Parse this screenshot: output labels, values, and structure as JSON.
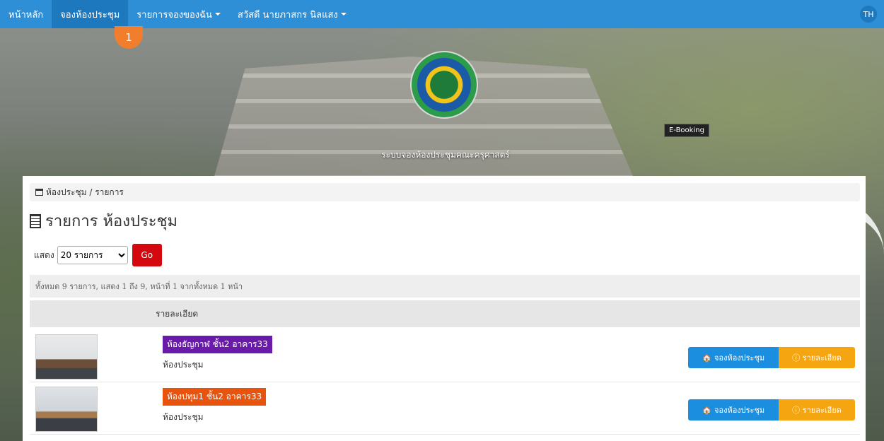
{
  "nav": {
    "home": "หน้าหลัก",
    "book_room": "จองห้องประชุม",
    "my_bookings": "รายการจองของฉัน",
    "user_greeting": "สวัสดี นายภาสกร นิลแสง",
    "lang": "TH",
    "marker": "1"
  },
  "hero": {
    "system_title": "ระบบจองห้องประชุมคณะครุศาสตร์",
    "tooltip": "E-Booking"
  },
  "breadcrumb": "ห้องประชุม / รายการ",
  "page_title": "รายการ ห้องประชุม",
  "filter": {
    "show_label": "แสดง",
    "selected": "20 รายการ",
    "go_label": "Go"
  },
  "summary": "ทั้งหมด 9 รายการ, แสดง 1 ถึง 9, หน้าที่ 1 จากทั้งหมด 1 หน้า",
  "table": {
    "header_detail": "รายละเอียด",
    "rows": [
      {
        "room": "ห้องธัญกาฬ ชั้น2 อาคาร33",
        "type": "ห้องประชุม",
        "book_label": "จองห้องประชุม",
        "detail_label": "รายละเอียด"
      },
      {
        "room": "ห้องปทุม1 ชั้น2 อาคาร33",
        "type": "ห้องประชุม",
        "book_label": "จองห้องประชุม",
        "detail_label": "รายละเอียด"
      }
    ]
  },
  "colors": {
    "navbar": "#2f8fd6",
    "go_button": "#d4080f",
    "room_purple": "#6a1aa8",
    "room_orange": "#e8530e",
    "book_button": "#1c8ee0",
    "detail_button": "#f5a50f"
  }
}
